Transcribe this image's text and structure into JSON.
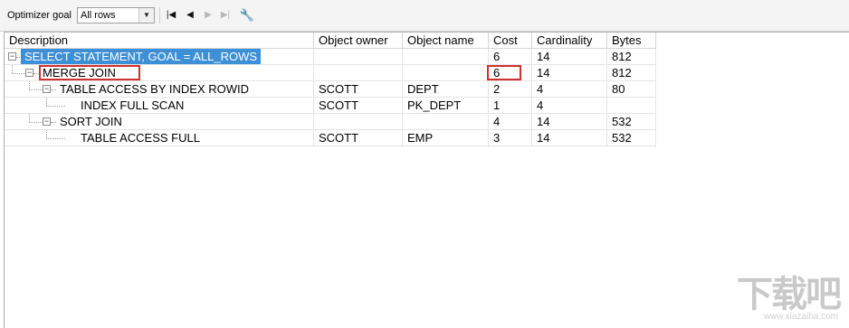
{
  "toolbar": {
    "optimizer_label": "Optimizer goal",
    "goal_select_value": "All rows",
    "first_icon": "first-record-icon",
    "prev_icon": "previous-record-icon",
    "next_icon": "next-record-icon",
    "last_icon": "last-record-icon",
    "settings_icon": "wrench-icon"
  },
  "table": {
    "columns": [
      "Description",
      "Object owner",
      "Object name",
      "Cost",
      "Cardinality",
      "Bytes"
    ],
    "rows": [
      {
        "description": "SELECT STATEMENT, GOAL = ALL_ROWS",
        "owner": "",
        "name": "",
        "cost": "6",
        "cardinality": "14",
        "bytes": "812",
        "level": 0,
        "expander": "minus",
        "selected": true
      },
      {
        "description": "MERGE JOIN",
        "owner": "",
        "name": "",
        "cost": "6",
        "cardinality": "14",
        "bytes": "812",
        "level": 1,
        "expander": "minus",
        "highlight_desc": true,
        "highlight_cost": true
      },
      {
        "description": "TABLE ACCESS BY INDEX ROWID",
        "owner": "SCOTT",
        "name": "DEPT",
        "cost": "2",
        "cardinality": "4",
        "bytes": "80",
        "level": 2,
        "expander": "minus"
      },
      {
        "description": "INDEX FULL SCAN",
        "owner": "SCOTT",
        "name": "PK_DEPT",
        "cost": "1",
        "cardinality": "4",
        "bytes": "",
        "level": 3,
        "expander": "none"
      },
      {
        "description": "SORT JOIN",
        "owner": "",
        "name": "",
        "cost": "4",
        "cardinality": "14",
        "bytes": "532",
        "level": 2,
        "expander": "minus"
      },
      {
        "description": "TABLE ACCESS FULL",
        "owner": "SCOTT",
        "name": "EMP",
        "cost": "3",
        "cardinality": "14",
        "bytes": "532",
        "level": 3,
        "expander": "none"
      }
    ]
  },
  "colors": {
    "selection": "#3d8fd6",
    "highlight_box": "#d03030"
  },
  "watermark": {
    "main": "下载吧",
    "sub": "www.xiazaiba.com"
  }
}
